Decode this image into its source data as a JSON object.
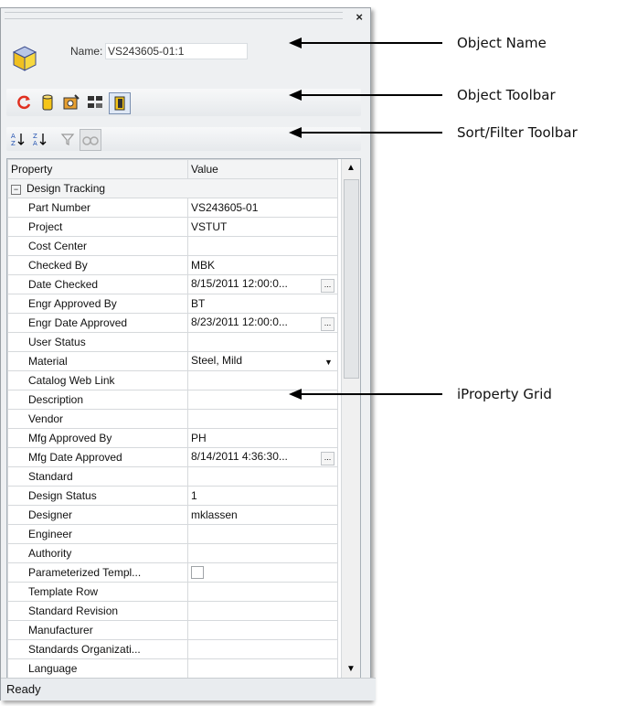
{
  "object_name": {
    "label": "Name:",
    "value": "VS243605-01:1"
  },
  "toolbar_icons": [
    "refresh-icon",
    "part-icon",
    "material-icon",
    "grid-view-icon",
    "display-mode-icon"
  ],
  "sort_icons": [
    "sort-ascending-icon",
    "sort-descending-icon",
    "filter-icon",
    "find-icon"
  ],
  "grid": {
    "headers": {
      "property": "Property",
      "value": "Value"
    },
    "category": "Design Tracking",
    "rows": [
      {
        "p": "Part Number",
        "v": "VS243605-01"
      },
      {
        "p": "Project",
        "v": "VSTUT"
      },
      {
        "p": "Cost Center",
        "v": ""
      },
      {
        "p": "Checked By",
        "v": "MBK"
      },
      {
        "p": "Date Checked",
        "v": "8/15/2011  12:00:0...",
        "btn": "..."
      },
      {
        "p": "Engr Approved By",
        "v": "BT"
      },
      {
        "p": "Engr Date Approved",
        "v": "8/23/2011  12:00:0...",
        "btn": "..."
      },
      {
        "p": "User Status",
        "v": ""
      },
      {
        "p": "Material",
        "v": "Steel, Mild",
        "dd": "▼"
      },
      {
        "p": "Catalog Web Link",
        "v": ""
      },
      {
        "p": "Description",
        "v": ""
      },
      {
        "p": "Vendor",
        "v": ""
      },
      {
        "p": "Mfg Approved By",
        "v": "PH"
      },
      {
        "p": "Mfg Date Approved",
        "v": "8/14/2011  4:36:30...",
        "btn": "..."
      },
      {
        "p": "Standard",
        "v": ""
      },
      {
        "p": "Design Status",
        "v": "1"
      },
      {
        "p": "Designer",
        "v": "mklassen"
      },
      {
        "p": "Engineer",
        "v": ""
      },
      {
        "p": "Authority",
        "v": ""
      },
      {
        "p": "Parameterized Templ...",
        "v": "",
        "check": true
      },
      {
        "p": "Template Row",
        "v": ""
      },
      {
        "p": "Standard Revision",
        "v": ""
      },
      {
        "p": "Manufacturer",
        "v": ""
      },
      {
        "p": "Standards Organizati...",
        "v": ""
      },
      {
        "p": "Language",
        "v": ""
      }
    ]
  },
  "status": "Ready",
  "callouts": {
    "object_name": "Object Name",
    "object_toolbar": "Object Toolbar",
    "sort_filter_toolbar": "Sort/Filter Toolbar",
    "iproperty_grid": "iProperty Grid"
  }
}
